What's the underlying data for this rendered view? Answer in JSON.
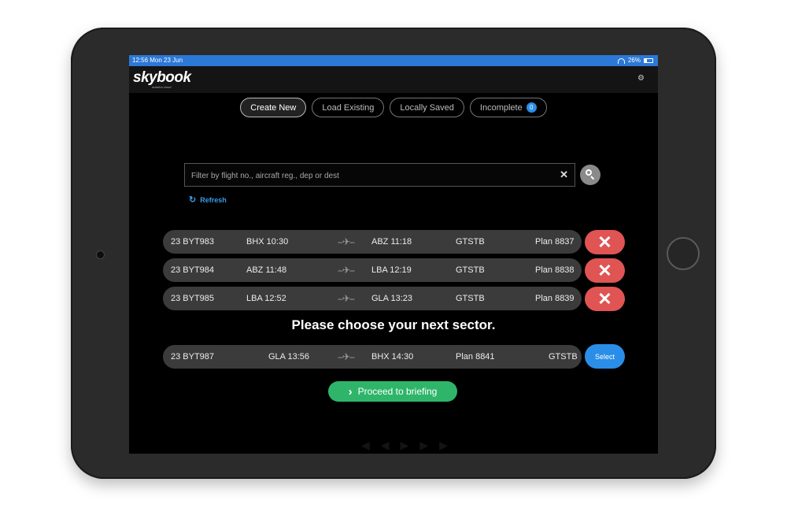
{
  "status_bar": {
    "time": "12:56  Mon 23 Jun",
    "battery": "26%"
  },
  "app": {
    "logo": "skybook",
    "logo_sub": "aviation cloud"
  },
  "tabs": [
    {
      "label": "Create New",
      "active": true
    },
    {
      "label": "Load Existing"
    },
    {
      "label": "Locally Saved"
    },
    {
      "label": "Incomplete",
      "badge": "0"
    }
  ],
  "search": {
    "placeholder": "Filter by flight no., aircraft reg., dep or dest",
    "clear_icon": "close-icon",
    "button_icon": "search-icon"
  },
  "refresh": {
    "label": "Refresh"
  },
  "selected_flights": [
    {
      "flight": "23 BYT983",
      "dep": "BHX 10:30",
      "arr": "ABZ 11:18",
      "reg": "GTSTB",
      "plan": "Plan 8837"
    },
    {
      "flight": "23 BYT984",
      "dep": "ABZ 11:48",
      "arr": "LBA 12:19",
      "reg": "GTSTB",
      "plan": "Plan 8838"
    },
    {
      "flight": "23 BYT985",
      "dep": "LBA 12:52",
      "arr": "GLA 13:23",
      "reg": "GTSTB",
      "plan": "Plan 8839"
    }
  ],
  "prompt": "Please choose your next sector.",
  "next_sector": {
    "flight": "23 BYT987",
    "dep": "GLA 13:56",
    "arr": "BHX 14:30",
    "plan": "Plan 8841",
    "reg": "GTSTB",
    "button": "Select"
  },
  "proceed": {
    "label": "Proceed to briefing"
  },
  "colors": {
    "status_bar": "#2c78d6",
    "remove": "#e05454",
    "select": "#2a8ee8",
    "proceed": "#2fb56a",
    "row": "#3b3b3b"
  }
}
